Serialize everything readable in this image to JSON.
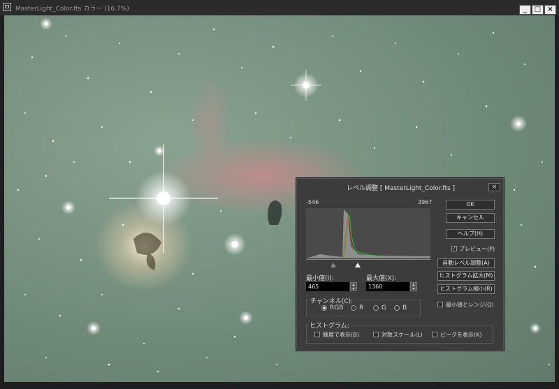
{
  "window": {
    "title": "MasterLight_Color.fts カラー (16.7%)",
    "minimize_label": "_",
    "maximize_label": "□",
    "close_label": "×"
  },
  "dialog": {
    "title": "レベル調整 [ MasterLight_Color.fts ]",
    "close_label": "×",
    "histogram": {
      "range_min": "-546",
      "range_max": "3967"
    },
    "min_label": "最小値(I):",
    "min_value": "465",
    "max_label": "最大値(X):",
    "max_value": "1360",
    "channel": {
      "label": "チャンネル(C):",
      "options": [
        "RGB",
        "R",
        "G",
        "B"
      ],
      "selected": "RGB"
    },
    "histogram_group": {
      "label": "ヒストグラム:",
      "options": [
        "輝度で表示(B)",
        "対数スケール(L)",
        "ピークを表示(K)"
      ]
    },
    "buttons": {
      "ok": "OK",
      "cancel": "キャンセル",
      "help": "ヘルプ(H)",
      "auto_level": "自動レベル調整(A)",
      "hist_expand": "ヒストグラム拡大(M)",
      "hist_shrink": "ヒストグラム縮小(R)"
    },
    "preview": {
      "label": "プレビュー(P)",
      "checked": true
    },
    "min_and_range": {
      "label": "最小値とレンジ(Q)",
      "checked": false
    }
  }
}
